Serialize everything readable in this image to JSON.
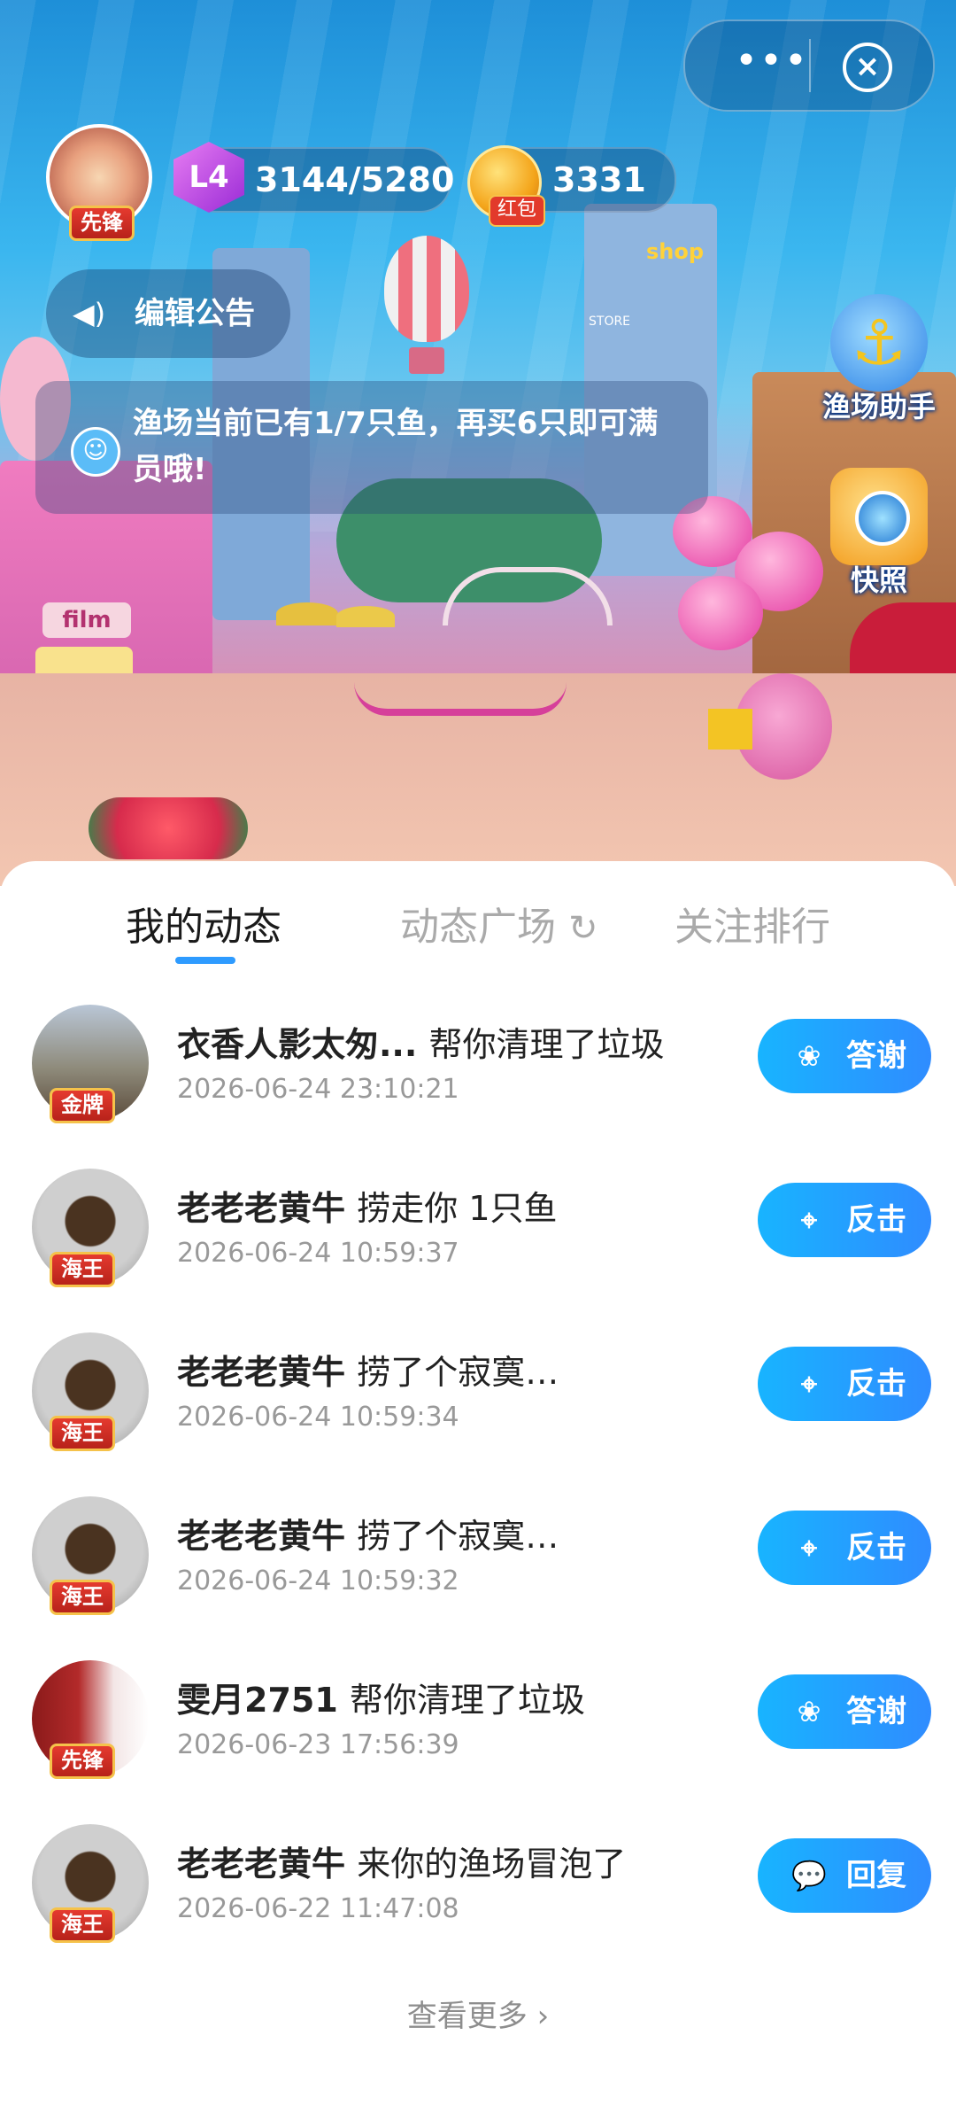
{
  "capsule": {
    "more_icon": "ellipsis-icon",
    "close_icon": "close-icon"
  },
  "header": {
    "avatar_badge": "先锋",
    "level": "L4",
    "exp": "3144/5280",
    "coins": "3331",
    "coin_badge": "红包",
    "notice_label": "编辑公告"
  },
  "scene_signs": {
    "shop": "shop",
    "store": "STORE",
    "film": "film"
  },
  "message": "渔场当前已有1/7只鱼，再买6只即可满员哦!",
  "side_buttons": [
    {
      "label": "渔场助手",
      "icon": "anchor-icon"
    },
    {
      "label": "快照",
      "icon": "camera-icon"
    }
  ],
  "tabs": [
    "我的动态",
    "动态广场",
    "关注排行"
  ],
  "refresh_icon": "refresh-icon",
  "feed": [
    {
      "name": "衣香人影太匆...",
      "action": "帮你清理了垃圾",
      "time": "2026-06-24 23:10:21",
      "badge": "金牌",
      "button": "答谢",
      "button_icon": "flower-icon",
      "avatar": "trees"
    },
    {
      "name": "老老老黄牛",
      "action": "捞走你 1只鱼",
      "time": "2026-06-24 10:59:37",
      "badge": "海王",
      "button": "反击",
      "button_icon": "net-icon",
      "avatar": "coffee"
    },
    {
      "name": "老老老黄牛",
      "action": "捞了个寂寞…",
      "time": "2026-06-24 10:59:34",
      "badge": "海王",
      "button": "反击",
      "button_icon": "net-icon",
      "avatar": "coffee"
    },
    {
      "name": "老老老黄牛",
      "action": "捞了个寂寞…",
      "time": "2026-06-24 10:59:32",
      "badge": "海王",
      "button": "反击",
      "button_icon": "net-icon",
      "avatar": "coffee"
    },
    {
      "name": "雯月2751",
      "action": "帮你清理了垃圾",
      "time": "2026-06-23 17:56:39",
      "badge": "先锋",
      "button": "答谢",
      "button_icon": "flower-icon",
      "avatar": "girl"
    },
    {
      "name": "老老老黄牛",
      "action": "来你的渔场冒泡了",
      "time": "2026-06-22 11:47:08",
      "badge": "海王",
      "button": "回复",
      "button_icon": "chat-icon",
      "avatar": "coffee"
    }
  ],
  "more": "查看更多",
  "colors": {
    "accent": "#2e9bff",
    "button": "#18b4ff",
    "badge_red": "#c9281d"
  }
}
